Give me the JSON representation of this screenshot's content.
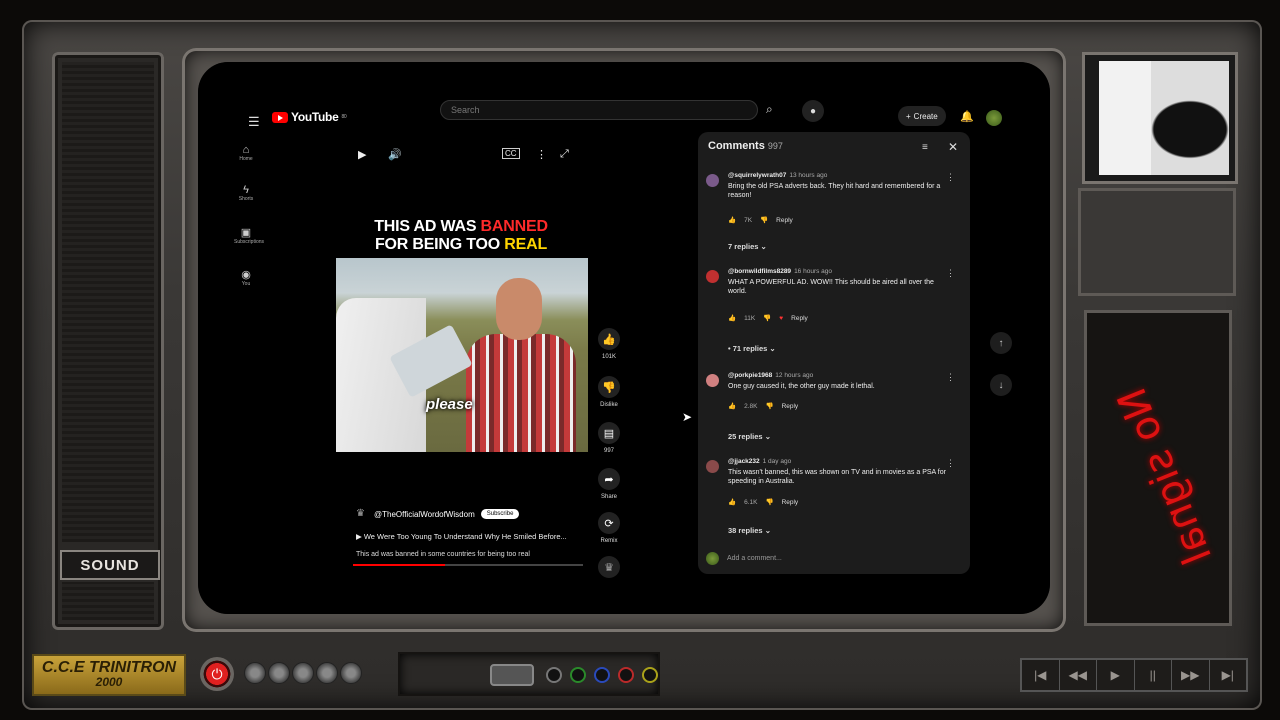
{
  "tv": {
    "sound_label": "SOUND",
    "brand_line1": "C.C.E TRINITRON",
    "brand_line2": "2000",
    "no_signal_text": "No signal"
  },
  "youtube": {
    "logo_text": "YouTube",
    "logo_region": "80",
    "search_placeholder": "Search",
    "create_label": "Create",
    "sidebar": [
      {
        "label": "Home",
        "icon": "home-icon"
      },
      {
        "label": "Shorts",
        "icon": "shorts-icon"
      },
      {
        "label": "Subscriptions",
        "icon": "subscriptions-icon"
      },
      {
        "label": "You",
        "icon": "you-icon"
      }
    ],
    "video": {
      "headline_part1": "THIS AD WAS ",
      "headline_banned": "BANNED",
      "headline_part2": "FOR BEING TOO ",
      "headline_real": "REAL",
      "caption": "please",
      "channel": "@TheOfficialWordofWisdom",
      "subscribe_label": "Subscribe",
      "title": "We Were Too Young To Understand Why He Smiled Before...",
      "description": "This ad was banned in some countries for being too real",
      "progress": 0.4
    },
    "actions": [
      {
        "icon": "like-icon",
        "label": "101K"
      },
      {
        "icon": "dislike-icon",
        "label": "Dislike"
      },
      {
        "icon": "comment-icon",
        "label": "997"
      },
      {
        "icon": "share-icon",
        "label": "Share"
      },
      {
        "icon": "remix-icon",
        "label": "Remix"
      }
    ],
    "comments_panel": {
      "title": "Comments",
      "count": "997",
      "add_placeholder": "Add a comment...",
      "items": [
        {
          "user": "@squirrelywrath07",
          "time": "13 hours ago",
          "text": "Bring the old PSA adverts back. They hit hard and remembered for a reason!",
          "likes": "7K",
          "reply_label": "Reply",
          "replies": "7 replies",
          "avatar_color": "#7a5a8a"
        },
        {
          "user": "@bornwildfilms8289",
          "time": "16 hours ago",
          "text": "WHAT A POWERFUL AD.  WOW!!   This should be aired all over the world.",
          "likes": "11K",
          "reply_label": "Reply",
          "replies": "• 71 replies",
          "avatar_color": "#c03030"
        },
        {
          "user": "@porkpie1968",
          "time": "12 hours ago",
          "text": "One guy caused it, the other guy made it lethal.",
          "likes": "2.8K",
          "reply_label": "Reply",
          "replies": "25 replies",
          "avatar_color": "#d08080"
        },
        {
          "user": "@jjack232",
          "time": "1 day ago",
          "text": "This wasn't banned, this was shown on TV and in movies as a PSA for speeding in Australia.",
          "likes": "6.1K",
          "reply_label": "Reply",
          "replies": "38 replies",
          "avatar_color": "#8a4a4a"
        }
      ]
    }
  }
}
